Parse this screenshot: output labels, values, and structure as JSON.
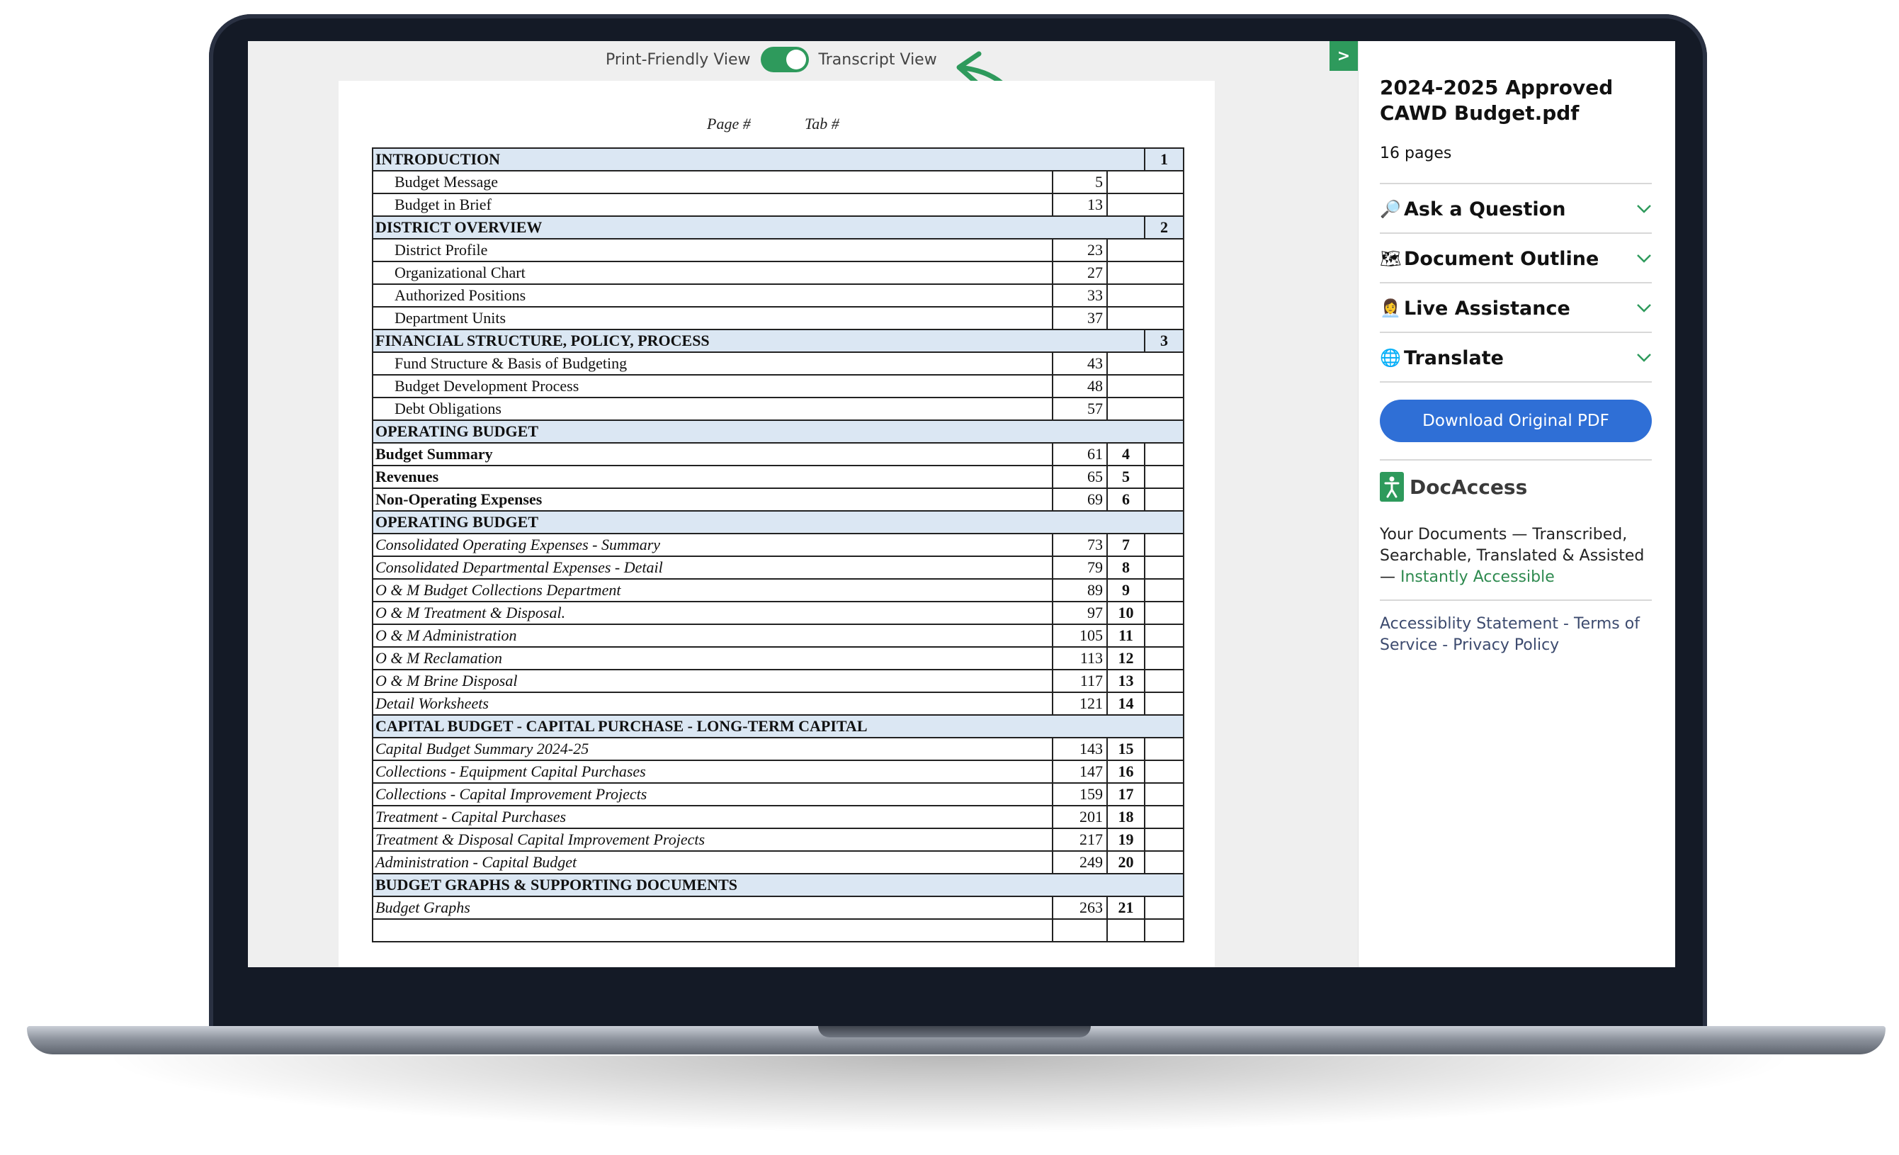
{
  "view_toggle": {
    "left_label": "Print-Friendly View",
    "right_label": "Transcript View",
    "state": "on",
    "accent": "#2e9a5c"
  },
  "side_toggle_glyph": ">",
  "document": {
    "column_headers": {
      "page": "Page #",
      "tab": "Tab #"
    },
    "rows": [
      {
        "kind": "section",
        "name": "INTRODUCTION",
        "tab": "1"
      },
      {
        "kind": "sub",
        "name": "Budget Message",
        "page": "5"
      },
      {
        "kind": "sub",
        "name": "Budget in Brief",
        "page": "13"
      },
      {
        "kind": "section",
        "name": "DISTRICT OVERVIEW",
        "tab": "2"
      },
      {
        "kind": "sub",
        "name": "District Profile",
        "page": "23"
      },
      {
        "kind": "sub",
        "name": "Organizational Chart",
        "page": "27"
      },
      {
        "kind": "sub",
        "name": "Authorized Positions",
        "page": "33"
      },
      {
        "kind": "sub",
        "name": "Department Units",
        "page": "37"
      },
      {
        "kind": "section",
        "name": "FINANCIAL STRUCTURE, POLICY, PROCESS",
        "tab": "3"
      },
      {
        "kind": "sub",
        "name": "Fund Structure & Basis of Budgeting",
        "page": "43"
      },
      {
        "kind": "sub",
        "name": "Budget Development Process",
        "page": "48"
      },
      {
        "kind": "sub",
        "name": "Debt Obligations",
        "page": "57"
      },
      {
        "kind": "header",
        "name": "OPERATING BUDGET"
      },
      {
        "kind": "bold",
        "name": "Budget Summary",
        "page": "61",
        "tab": "4"
      },
      {
        "kind": "bold",
        "name": "Revenues",
        "page": "65",
        "tab": "5"
      },
      {
        "kind": "bold",
        "name": "Non-Operating Expenses",
        "page": "69",
        "tab": "6"
      },
      {
        "kind": "header",
        "name": "OPERATING BUDGET"
      },
      {
        "kind": "ital",
        "name": "Consolidated Operating Expenses - Summary",
        "page": "73",
        "tab": "7"
      },
      {
        "kind": "ital",
        "name": "Consolidated Departmental Expenses - Detail",
        "page": "79",
        "tab": "8"
      },
      {
        "kind": "ital",
        "name": "O & M Budget Collections Department",
        "page": "89",
        "tab": "9"
      },
      {
        "kind": "ital",
        "name": "O & M Treatment & Disposal.",
        "page": "97",
        "tab": "10"
      },
      {
        "kind": "ital",
        "name": "O & M Administration",
        "page": "105",
        "tab": "11"
      },
      {
        "kind": "ital",
        "name": "O & M Reclamation",
        "page": "113",
        "tab": "12"
      },
      {
        "kind": "ital",
        "name": "O & M Brine Disposal",
        "page": "117",
        "tab": "13"
      },
      {
        "kind": "ital",
        "name": "Detail Worksheets",
        "page": "121",
        "tab": "14"
      },
      {
        "kind": "header",
        "name": "CAPITAL BUDGET - CAPITAL PURCHASE - LONG-TERM CAPITAL"
      },
      {
        "kind": "ital",
        "name": "Capital Budget Summary 2024-25",
        "page": "143",
        "tab": "15"
      },
      {
        "kind": "ital",
        "name": "Collections - Equipment Capital Purchases",
        "page": "147",
        "tab": "16"
      },
      {
        "kind": "ital",
        "name": "Collections - Capital Improvement Projects",
        "page": "159",
        "tab": "17"
      },
      {
        "kind": "ital",
        "name": "Treatment - Capital Purchases",
        "page": "201",
        "tab": "18"
      },
      {
        "kind": "ital",
        "name": "Treatment & Disposal Capital Improvement Projects",
        "page": "217",
        "tab": "19"
      },
      {
        "kind": "ital",
        "name": "Administration - Capital Budget",
        "page": "249",
        "tab": "20"
      },
      {
        "kind": "header",
        "name": "BUDGET GRAPHS & SUPPORTING DOCUMENTS"
      },
      {
        "kind": "ital",
        "name": "Budget Graphs",
        "page": "263",
        "tab": "21"
      },
      {
        "kind": "ital",
        "name": "",
        "page": "",
        "tab": ""
      }
    ]
  },
  "sidebar": {
    "title": "2024-2025 Approved CAWD Budget.pdf",
    "pages": "16 pages",
    "accordion": [
      {
        "icon": "🔎",
        "icon_name": "magnifier-icon",
        "label": "Ask a Question"
      },
      {
        "icon": "🗺",
        "icon_name": "map-icon",
        "label": "Document Outline"
      },
      {
        "icon": "👩‍💼",
        "icon_name": "support-agent-icon",
        "label": "Live Assistance"
      },
      {
        "icon": "🌐",
        "icon_name": "globe-icon",
        "label": "Translate"
      }
    ],
    "download_label": "Download Original PDF",
    "download_color": "#2f6fd6",
    "brand_name": "DocAccess",
    "tagline_prefix": "Your Documents — Transcribed, Searchable, Translated & Assisted — ",
    "tagline_link": "Instantly Accessible",
    "footer": {
      "accessibility": "Accessiblity Statement",
      "sep1": " - ",
      "terms": "Terms of Service",
      "sep2": " - ",
      "privacy": "Privacy Policy"
    }
  }
}
